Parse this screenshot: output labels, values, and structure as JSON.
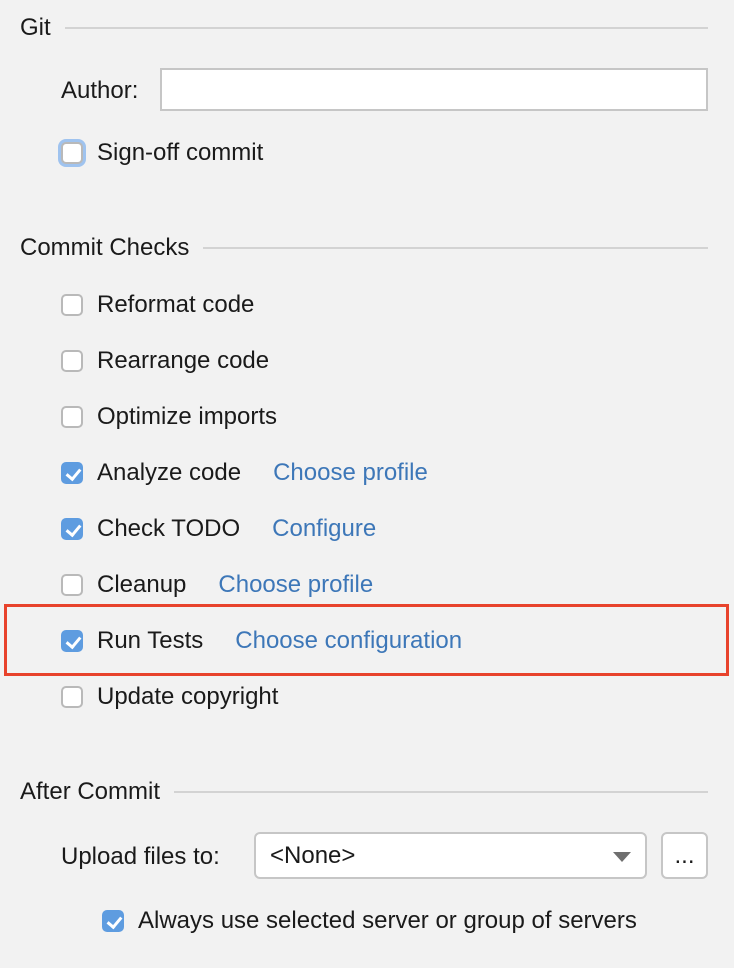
{
  "git": {
    "title": "Git",
    "author_label": "Author:",
    "author_value": "",
    "signoff": {
      "label": "Sign-off commit",
      "checked": false
    }
  },
  "commit_checks": {
    "title": "Commit Checks",
    "items": [
      {
        "label": "Reformat code",
        "checked": false,
        "link": null
      },
      {
        "label": "Rearrange code",
        "checked": false,
        "link": null
      },
      {
        "label": "Optimize imports",
        "checked": false,
        "link": null
      },
      {
        "label": "Analyze code",
        "checked": true,
        "link": "Choose profile"
      },
      {
        "label": "Check TODO",
        "checked": true,
        "link": "Configure"
      },
      {
        "label": "Cleanup",
        "checked": false,
        "link": "Choose profile"
      },
      {
        "label": "Run Tests",
        "checked": true,
        "link": "Choose configuration"
      },
      {
        "label": "Update copyright",
        "checked": false,
        "link": null
      }
    ]
  },
  "after_commit": {
    "title": "After Commit",
    "upload_label": "Upload files to:",
    "upload_value": "<None>",
    "browse_label": "...",
    "always_use": {
      "label": "Always use selected server or group of servers",
      "checked": true
    }
  },
  "colors": {
    "accent": "#5e9ce0",
    "link": "#3d77b8",
    "highlight": "#e8432c"
  }
}
